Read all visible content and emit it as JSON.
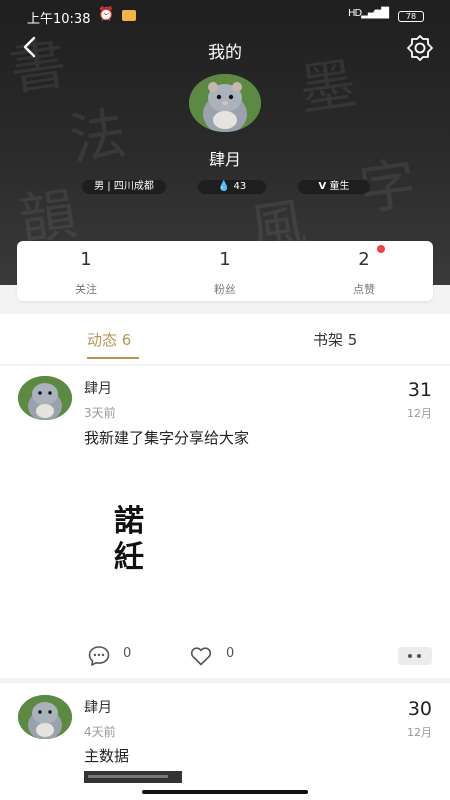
{
  "status_bar": {
    "time": "上午10:38",
    "signal": "HD",
    "battery": "78"
  },
  "nav": {
    "title": "我的"
  },
  "profile": {
    "name": "肆月",
    "gender_location": "男 | 四川成都",
    "drops": "43",
    "level": "童生"
  },
  "stats": [
    {
      "value": "1",
      "label": "关注"
    },
    {
      "value": "1",
      "label": "粉丝"
    },
    {
      "value": "2",
      "label": "点赞",
      "has_notification": true
    }
  ],
  "tabs": [
    {
      "label": "动态 6",
      "active": true
    },
    {
      "label": "书架 5",
      "active": false
    }
  ],
  "posts": [
    {
      "author": "肆月",
      "time": "3天前",
      "text": "我新建了集字分享给大家",
      "day": "31",
      "month": "12月",
      "artwork_text": "諾\n紝",
      "comments": "0",
      "likes": "0"
    },
    {
      "author": "肆月",
      "time": "4天前",
      "text": "主数据",
      "day": "30",
      "month": "12月"
    }
  ],
  "colors": {
    "accent": "#b8955a",
    "header_bg": "#262626",
    "notification_dot": "#ee4444"
  },
  "icons": [
    "back-icon",
    "settings-icon",
    "drop-icon",
    "level-icon",
    "comment-icon",
    "like-icon",
    "more-icon"
  ]
}
